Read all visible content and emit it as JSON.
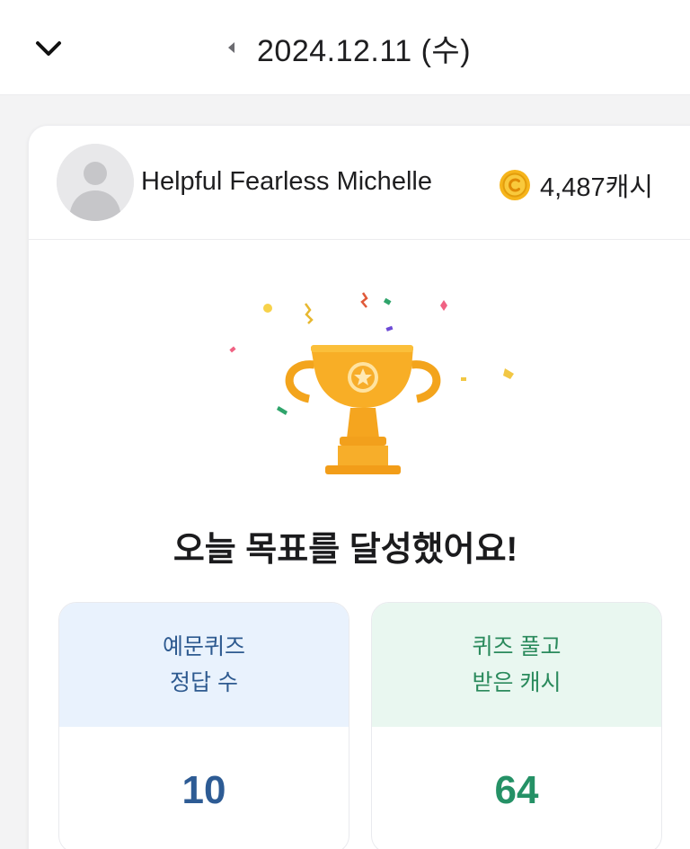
{
  "header": {
    "date": "2024.12.11 (수)"
  },
  "profile": {
    "user_name": "Helpful Fearless Michelle",
    "cash": "4,487캐시"
  },
  "main": {
    "goal_message": "오늘 목표를 달성했어요!"
  },
  "stats": [
    {
      "title_line1": "예문퀴즈",
      "title_line2": "정답 수",
      "value": "10"
    },
    {
      "title_line1": "퀴즈 풀고",
      "title_line2": "받은 캐시",
      "value": "64"
    }
  ],
  "colors": {
    "accent_blue": "#2d5b94",
    "accent_green": "#259166",
    "coin": "#f6b51c",
    "trophy": "#f7ac24"
  },
  "icons": [
    "chevron-down-icon",
    "caret-left-icon",
    "avatar-placeholder-icon",
    "coin-icon",
    "trophy-icon"
  ]
}
